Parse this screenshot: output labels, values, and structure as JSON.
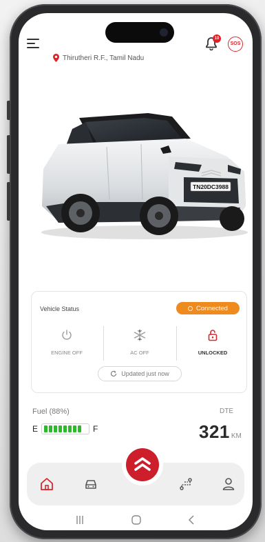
{
  "header": {
    "location": "Thirutheri R.F., Tamil Nadu",
    "notification_count": "10",
    "sos_label": "SOS"
  },
  "vehicle": {
    "plate": "TN20DC3988"
  },
  "status_card": {
    "title": "Vehicle Status",
    "connection": "Connected",
    "engine_label": "ENGINE OFF",
    "ac_label": "AC OFF",
    "lock_label": "UNLOCKED",
    "updated_text": "Updated just now"
  },
  "fuel": {
    "label": "Fuel (88%)",
    "level_percent": 88,
    "empty_label": "E",
    "full_label": "F",
    "dte_label": "DTE",
    "dte_value": "321",
    "dte_unit": "KM"
  },
  "nav": {
    "items": [
      "home-icon",
      "car-icon",
      "route-icon",
      "profile-icon"
    ],
    "center": "citroen-logo-icon",
    "active": "home-icon"
  },
  "colors": {
    "accent_red": "#d7262c",
    "connected_orange": "#ef8a1f",
    "fuel_green": "#2eb82e"
  }
}
